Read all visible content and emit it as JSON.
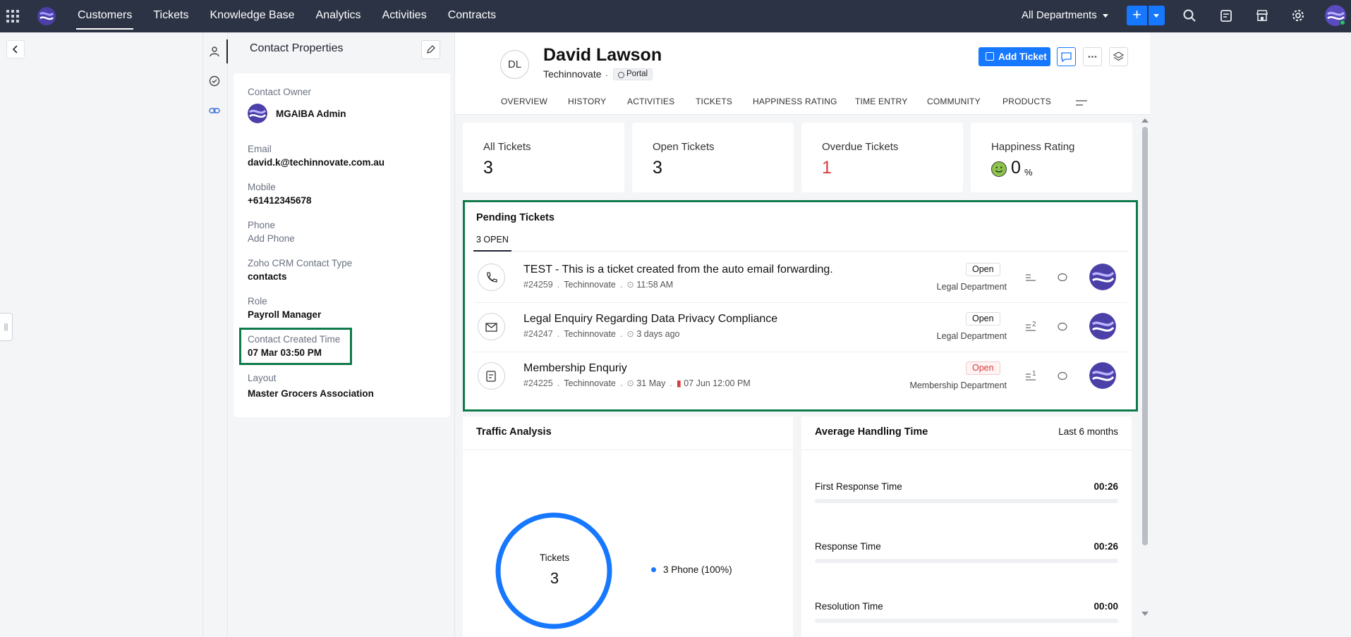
{
  "topbar": {
    "nav": [
      "Customers",
      "Tickets",
      "Knowledge Base",
      "Analytics",
      "Activities",
      "Contracts"
    ],
    "department": "All Departments",
    "plus_label": "+",
    "accent": "#1677ff",
    "bar_color": "#2b3345"
  },
  "props": {
    "title": "Contact Properties",
    "owner_label": "Contact Owner",
    "owner_name": "MGAIBA Admin",
    "email_label": "Email",
    "email": "david.k@techinnovate.com.au",
    "mobile_label": "Mobile",
    "mobile": "+61412345678",
    "phone_label": "Phone",
    "phone": "Add Phone",
    "crm_label": "Zoho CRM Contact Type",
    "crm_value": "contacts",
    "role_label": "Role",
    "role": "Payroll Manager",
    "created_label": "Contact Created Time",
    "created": "07 Mar 03:50 PM",
    "layout_label": "Layout",
    "layout": "Master Grocers Association"
  },
  "contact": {
    "initials": "DL",
    "name": "David Lawson",
    "company": "Techinnovate",
    "separator": ".",
    "portal": "Portal",
    "add_ticket": "Add Ticket"
  },
  "tabs": [
    "OVERVIEW",
    "HISTORY",
    "ACTIVITIES",
    "TICKETS",
    "HAPPINESS RATING",
    "TIME ENTRY",
    "COMMUNITY",
    "PRODUCTS"
  ],
  "stats": {
    "all_label": "All Tickets",
    "all_value": "3",
    "open_label": "Open Tickets",
    "open_value": "3",
    "overdue_label": "Overdue Tickets",
    "overdue_value": "1",
    "happy_label": "Happiness Rating",
    "happy_value": "0",
    "happy_unit": "%"
  },
  "pending": {
    "title": "Pending Tickets",
    "tab": "3 OPEN",
    "tickets": [
      {
        "subject": "TEST - This is a ticket created from the auto email forwarding.",
        "number": "#24259",
        "account": "Techinnovate",
        "time": "11:58 AM",
        "due": "",
        "status": "Open",
        "department": "Legal Department",
        "thread_count": "",
        "icon": "phone-icon"
      },
      {
        "subject": "Legal Enquiry Regarding Data Privacy Compliance",
        "number": "#24247",
        "account": "Techinnovate",
        "time": "3 days ago",
        "due": "",
        "status": "Open",
        "department": "Legal Department",
        "thread_count": "2",
        "icon": "email-icon"
      },
      {
        "subject": "Membership Enquriy",
        "number": "#24225",
        "account": "Techinnovate",
        "time": "31 May",
        "due": "07 Jun 12:00 PM",
        "status": "Open",
        "department": "Membership Department",
        "thread_count": "1",
        "icon": "form-icon"
      }
    ]
  },
  "traffic": {
    "title": "Traffic Analysis",
    "center_label": "Tickets",
    "center_value": "3",
    "legend": "3 Phone (100%)"
  },
  "aht": {
    "title": "Average Handling Time",
    "period": "Last 6 months",
    "rows": [
      {
        "label": "First Response Time",
        "value": "00:26"
      },
      {
        "label": "Response Time",
        "value": "00:26"
      },
      {
        "label": "Resolution Time",
        "value": "00:00"
      }
    ]
  },
  "chart_data": {
    "type": "pie",
    "title": "Traffic Analysis",
    "categories": [
      "Phone"
    ],
    "values": [
      3
    ],
    "labels": [
      "3 Phone (100%)"
    ]
  }
}
